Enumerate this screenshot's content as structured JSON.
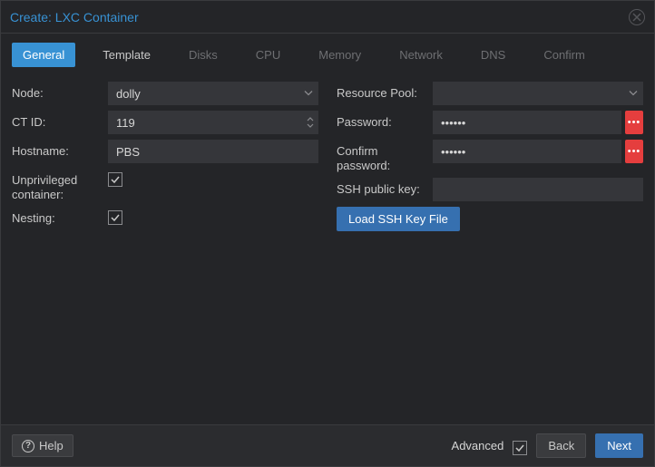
{
  "window": {
    "title": "Create: LXC Container"
  },
  "tabs": [
    {
      "label": "General",
      "state": "active"
    },
    {
      "label": "Template",
      "state": "normal"
    },
    {
      "label": "Disks",
      "state": "disabled"
    },
    {
      "label": "CPU",
      "state": "disabled"
    },
    {
      "label": "Memory",
      "state": "disabled"
    },
    {
      "label": "Network",
      "state": "disabled"
    },
    {
      "label": "DNS",
      "state": "disabled"
    },
    {
      "label": "Confirm",
      "state": "disabled"
    }
  ],
  "left": {
    "node": {
      "label": "Node:",
      "value": "dolly"
    },
    "ctid": {
      "label": "CT ID:",
      "value": "119"
    },
    "hostname": {
      "label": "Hostname:",
      "value": "PBS"
    },
    "unpriv": {
      "label": "Unprivileged container:",
      "checked": true
    },
    "nesting": {
      "label": "Nesting:",
      "checked": true
    }
  },
  "right": {
    "pool": {
      "label": "Resource Pool:",
      "value": ""
    },
    "password": {
      "label": "Password:",
      "value": "••••••"
    },
    "confirm": {
      "label": "Confirm password:",
      "value": "••••••"
    },
    "sshkey": {
      "label": "SSH public key:",
      "value": ""
    },
    "loadssh": {
      "label": "Load SSH Key File"
    }
  },
  "footer": {
    "help": "Help",
    "advanced": "Advanced",
    "advanced_checked": true,
    "back": "Back",
    "next": "Next"
  }
}
